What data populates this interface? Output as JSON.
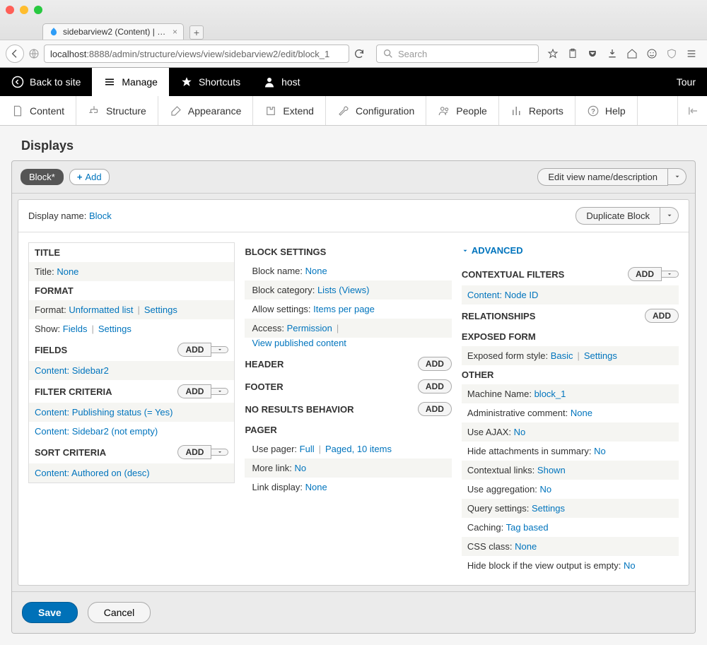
{
  "browser": {
    "tab_title": "sidebarview2 (Content) | H...",
    "url_host": "localhost",
    "url_path": ":8888/admin/structure/views/view/sidebarview2/edit/block_1",
    "search_placeholder": "Search"
  },
  "admin_toolbar": {
    "back": "Back to site",
    "manage": "Manage",
    "shortcuts": "Shortcuts",
    "user": "host",
    "tour": "Tour"
  },
  "admin_menu": {
    "content": "Content",
    "structure": "Structure",
    "appearance": "Appearance",
    "extend": "Extend",
    "configuration": "Configuration",
    "people": "People",
    "reports": "Reports",
    "help": "Help"
  },
  "page": {
    "title": "Displays",
    "display_pill": "Block*",
    "add_display": "Add",
    "edit_view": "Edit view name/description",
    "display_name_label": "Display name:",
    "display_name_value": "Block",
    "duplicate": "Duplicate Block",
    "save": "Save",
    "cancel": "Cancel"
  },
  "col1": {
    "title_h": "TITLE",
    "title_label": "Title:",
    "title_value": "None",
    "format_h": "FORMAT",
    "format_label": "Format:",
    "format_value": "Unformatted list",
    "settings": "Settings",
    "show_label": "Show:",
    "show_value": "Fields",
    "fields_h": "FIELDS",
    "field1": "Content: Sidebar2",
    "filter_h": "FILTER CRITERIA",
    "filter1": "Content: Publishing status (= Yes)",
    "filter2": "Content: Sidebar2 (not empty)",
    "sort_h": "SORT CRITERIA",
    "sort1": "Content: Authored on (desc)",
    "add": "Add"
  },
  "col2": {
    "block_h": "BLOCK SETTINGS",
    "bname_l": "Block name:",
    "bname_v": "None",
    "bcat_l": "Block category:",
    "bcat_v": "Lists (Views)",
    "allow_l": "Allow settings:",
    "allow_v": "Items per page",
    "access_l": "Access:",
    "access_v": "Permission",
    "access_detail": "View published content",
    "header_h": "HEADER",
    "footer_h": "FOOTER",
    "nores_h": "NO RESULTS BEHAVIOR",
    "pager_h": "PAGER",
    "pager_l": "Use pager:",
    "pager_v": "Full",
    "pager_detail": "Paged, 10 items",
    "more_l": "More link:",
    "more_v": "No",
    "link_l": "Link display:",
    "link_v": "None",
    "add": "Add"
  },
  "col3": {
    "advanced": "ADVANCED",
    "cf_h": "CONTEXTUAL FILTERS",
    "cf1": "Content: Node ID",
    "rel_h": "RELATIONSHIPS",
    "ef_h": "EXPOSED FORM",
    "ef_l": "Exposed form style:",
    "ef_v": "Basic",
    "settings": "Settings",
    "other_h": "OTHER",
    "mn_l": "Machine Name:",
    "mn_v": "block_1",
    "ac_l": "Administrative comment:",
    "ac_v": "None",
    "ajax_l": "Use AJAX:",
    "ajax_v": "No",
    "hide_l": "Hide attachments in summary:",
    "hide_v": "No",
    "ctx_l": "Contextual links:",
    "ctx_v": "Shown",
    "agg_l": "Use aggregation:",
    "agg_v": "No",
    "qs_l": "Query settings:",
    "qs_v": "Settings",
    "cache_l": "Caching:",
    "cache_v": "Tag based",
    "css_l": "CSS class:",
    "css_v": "None",
    "hideempty_l": "Hide block if the view output is empty:",
    "hideempty_v": "No",
    "add": "Add"
  }
}
